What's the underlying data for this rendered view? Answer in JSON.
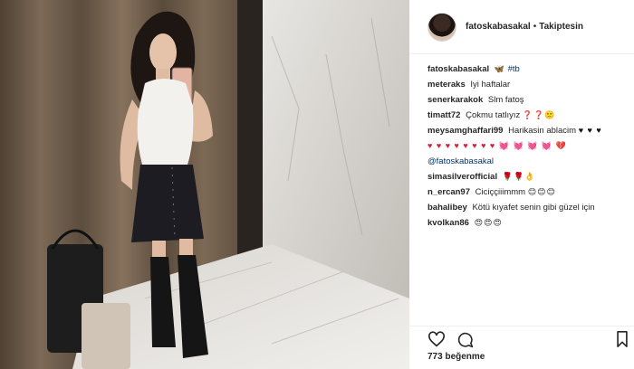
{
  "post": {
    "username": "fatoskabasakal",
    "separator": "•",
    "follow_status": "Takiptesin",
    "likes_text": "773 beğenme"
  },
  "comments": [
    {
      "user": "fatoskabasakal",
      "text": "",
      "emoji": "🦋",
      "tag": "#tb"
    },
    {
      "user": "meteraks",
      "text": "Iyi haftalar"
    },
    {
      "user": "senerkarakok",
      "text": "Slm fatoş"
    },
    {
      "user": "timatt72",
      "text": "Çokmu tatlıyız",
      "emoji": "❓❓🙂"
    },
    {
      "user": "meysamghaffari99",
      "text": "Harikasin ablacim",
      "emoji": "♥ ♥ ♥"
    },
    {
      "user": "",
      "text": "",
      "emoji": "♥ ♥ ♥ ♥ ♥ ♥ ♥ ♥ 💓 💓 💓 💓 💔"
    },
    {
      "user": "",
      "text": "",
      "tag": "@fatoskabasakal"
    },
    {
      "user": "simasilverofficial",
      "text": "",
      "emoji": "🌹🌹👌"
    },
    {
      "user": "n_ercan97",
      "text": "Ciciççiiimmm",
      "emoji": "😊😊😊"
    },
    {
      "user": "bahalibey",
      "text": "Kötü kıyafet senin gibi güzel için"
    },
    {
      "user": "kvolkan86",
      "text": "",
      "emoji": "😍😍😍"
    }
  ],
  "icons": {
    "like": "heart-icon",
    "comment": "comment-icon",
    "save": "bookmark-icon"
  }
}
